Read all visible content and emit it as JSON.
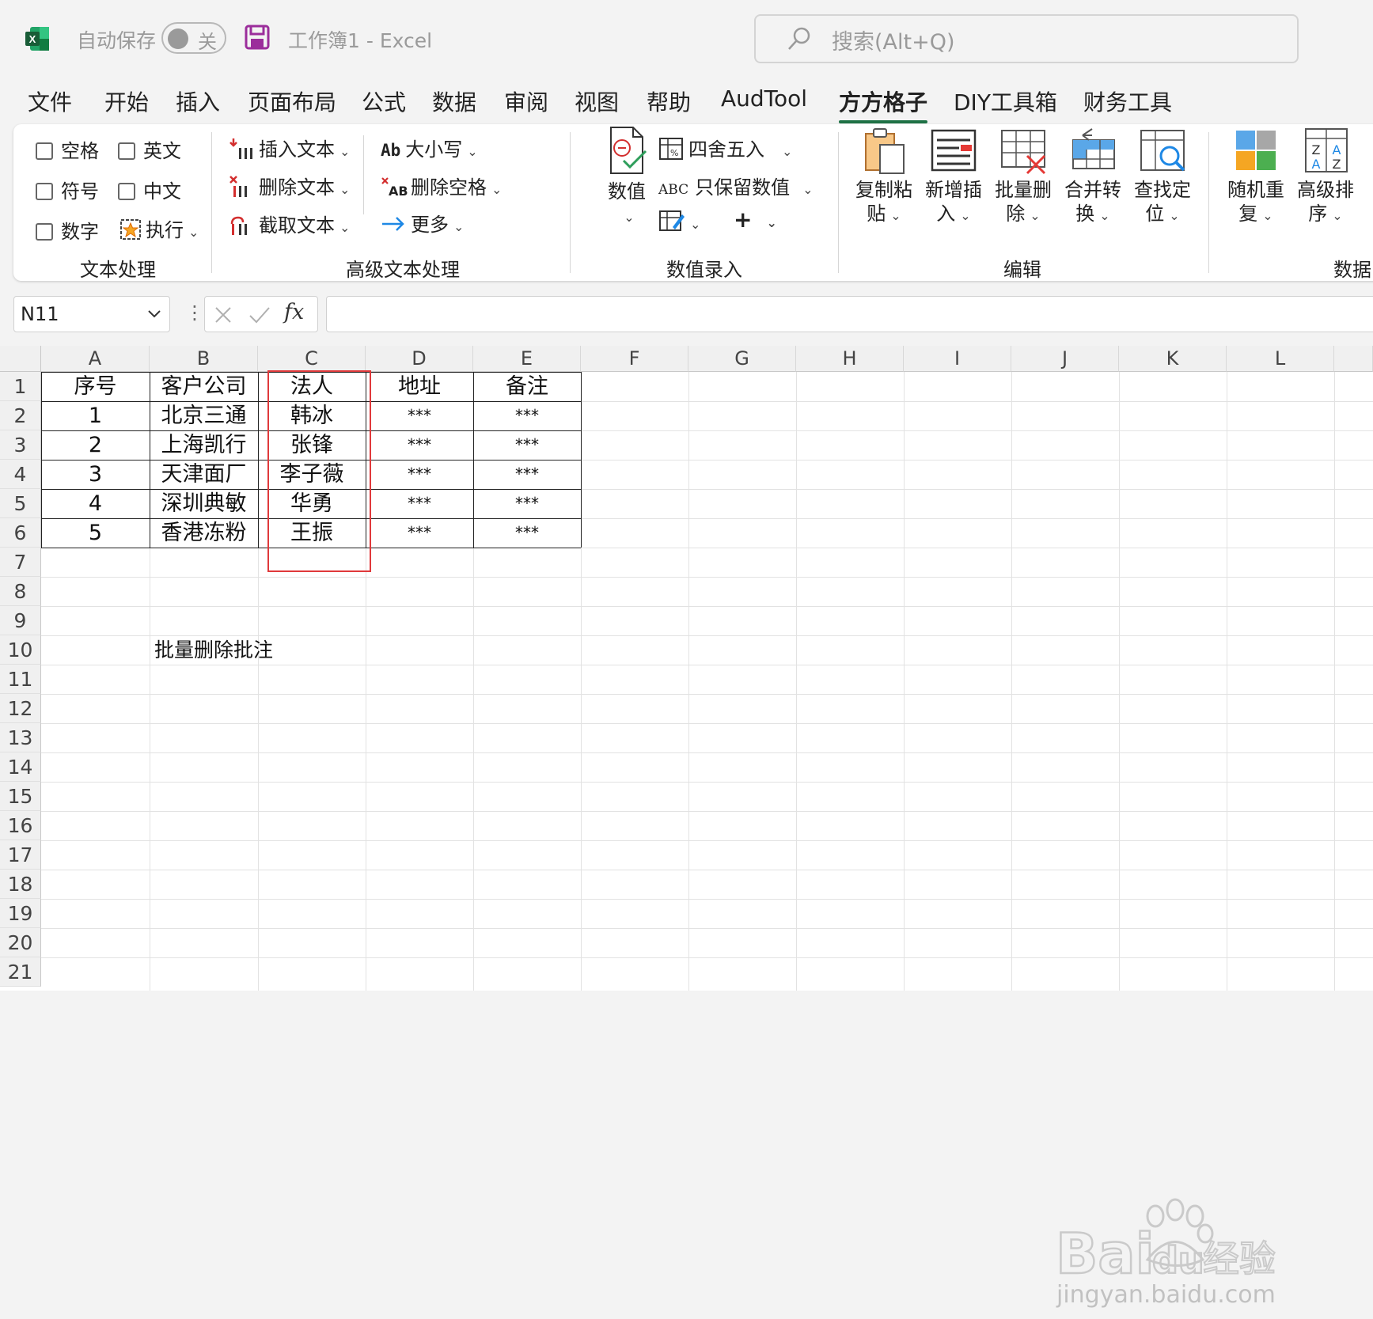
{
  "titlebar": {
    "autosave_label": "自动保存",
    "autosave_state": "关",
    "doc_title": "工作簿1  -  Excel",
    "search_placeholder": "搜索(Alt+Q)"
  },
  "menu": [
    "文件",
    "开始",
    "插入",
    "页面布局",
    "公式",
    "数据",
    "审阅",
    "视图",
    "帮助",
    "AudTool",
    "方方格子",
    "DIY工具箱",
    "财务工具"
  ],
  "menu_active": "方方格子",
  "ribbon": {
    "text_processing": {
      "group_label": "文本处理",
      "checkboxes": [
        "空格",
        "英文",
        "符号",
        "中文",
        "数字"
      ],
      "execute": "执行"
    },
    "advanced_text": {
      "group_label": "高级文本处理",
      "insert_text": "插入文本",
      "delete_text": "删除文本",
      "extract_text": "截取文本",
      "case": "大小写",
      "delete_space": "删除空格",
      "more": "更多"
    },
    "value_entry": {
      "group_label": "数值录入",
      "value": "数值",
      "round": "四舍五入",
      "keep_values": "只保留数值",
      "plus": "+"
    },
    "edit": {
      "group_label": "编辑",
      "copy_paste": [
        "复制粘",
        "贴"
      ],
      "new_insert": [
        "新增插",
        "入"
      ],
      "batch_delete": [
        "批量删",
        "除"
      ],
      "merge_convert": [
        "合并转",
        "换"
      ],
      "find_locate": [
        "查找定",
        "位"
      ]
    },
    "data_group": {
      "group_label": "数据",
      "random_repeat": [
        "随机重",
        "复"
      ],
      "advanced_sort": [
        "高级排",
        "序"
      ]
    }
  },
  "formula_bar": {
    "name_box": "N11",
    "fx": "fx",
    "value": ""
  },
  "sheet": {
    "columns": [
      "A",
      "B",
      "C",
      "D",
      "E",
      "F",
      "G",
      "H",
      "I",
      "J",
      "K",
      "L"
    ],
    "rows": [
      "1",
      "2",
      "3",
      "4",
      "5",
      "6",
      "7",
      "8",
      "9",
      "10",
      "11",
      "12",
      "13",
      "14",
      "15",
      "16",
      "17",
      "18",
      "19",
      "20",
      "21"
    ],
    "table_header": [
      "序号",
      "客户公司",
      "法人",
      "地址",
      "备注"
    ],
    "table_rows": [
      [
        "1",
        "北京三通",
        "韩冰",
        "***",
        "***"
      ],
      [
        "2",
        "上海凯行",
        "张锋",
        "***",
        "***"
      ],
      [
        "3",
        "天津面厂",
        "李子薇",
        "***",
        "***"
      ],
      [
        "4",
        "深圳典敏",
        "华勇",
        "***",
        "***"
      ],
      [
        "5",
        "香港冻粉",
        "王振",
        "***",
        "***"
      ]
    ],
    "b10": "批量删除批注"
  },
  "watermark": {
    "brand": "Baidu经验",
    "url": "jingyan.baidu.com"
  },
  "colors": {
    "excel_green": "#1e7145",
    "highlight_red": "#e0393b",
    "save_purple": "#9b2d9b"
  }
}
